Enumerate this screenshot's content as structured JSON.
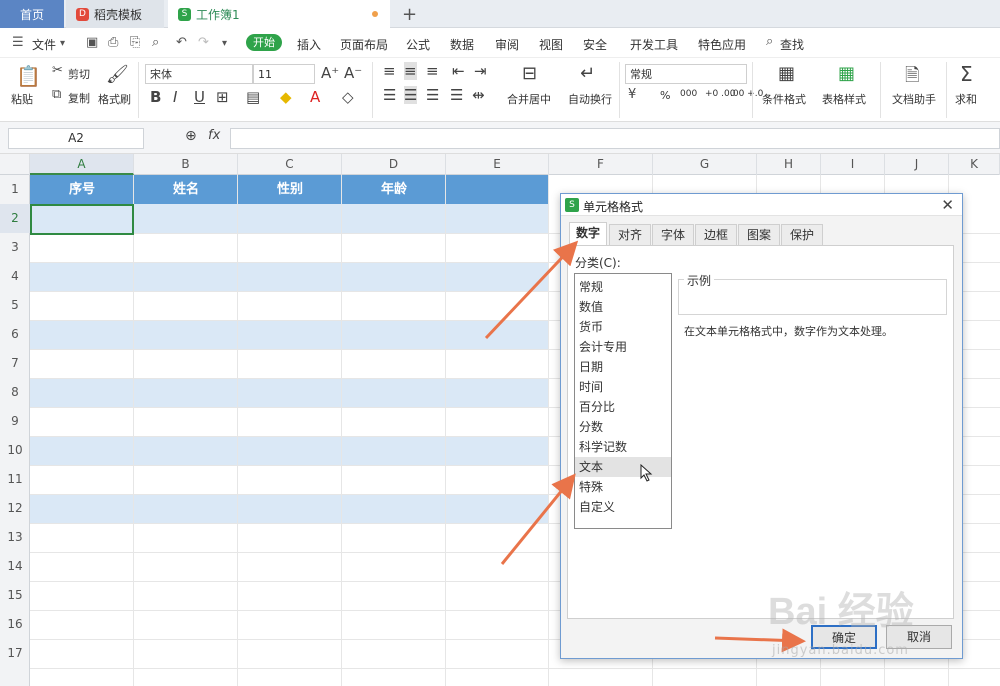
{
  "tabs": {
    "home": "首页",
    "template": "稻壳模板",
    "workbook": "工作簿1",
    "new_tab": "+"
  },
  "menu": {
    "file": "文件",
    "start": "开始",
    "items": [
      "插入",
      "页面布局",
      "公式",
      "数据",
      "审阅",
      "视图",
      "安全",
      "开发工具",
      "特色应用"
    ],
    "search": "查找"
  },
  "ribbon": {
    "paste": "粘贴",
    "cut": "剪切",
    "copy": "复制",
    "format_painter": "格式刷",
    "font_name": "宋体",
    "font_size": "11",
    "merge": "合并居中",
    "wrap": "自动换行",
    "number_format": "常规",
    "percent": "%",
    "thousands": "000",
    "inc_decimal": "+0 .00",
    "dec_decimal": ".00 +.0",
    "cond_format": "条件格式",
    "table_style": "表格样式",
    "doc_helper": "文档助手",
    "sum": "求和"
  },
  "formula_bar": {
    "cell_ref": "A2",
    "fx": "fx",
    "value": ""
  },
  "columns": [
    "A",
    "B",
    "C",
    "D",
    "E",
    "F",
    "G",
    "H",
    "I",
    "J",
    "K"
  ],
  "rows": [
    "1",
    "2",
    "3",
    "4",
    "5",
    "6",
    "7",
    "8",
    "9",
    "10",
    "11",
    "12",
    "13",
    "14",
    "15",
    "16",
    "17"
  ],
  "table_header": [
    "序号",
    "姓名",
    "性别",
    "年龄"
  ],
  "dialog": {
    "title": "单元格格式",
    "tabs": [
      "数字",
      "对齐",
      "字体",
      "边框",
      "图案",
      "保护"
    ],
    "category_label": "分类(C):",
    "categories": [
      "常规",
      "数值",
      "货币",
      "会计专用",
      "日期",
      "时间",
      "百分比",
      "分数",
      "科学记数",
      "文本",
      "特殊",
      "自定义"
    ],
    "selected_category": "文本",
    "sample_label": "示例",
    "description": "在文本单元格格式中，数字作为文本处理。",
    "ok": "确定",
    "cancel": "取消"
  },
  "watermark": {
    "logo": "Bai 经验",
    "url": "jingyan.baidu.com"
  },
  "colors": {
    "header_blue": "#5b9bd5",
    "band_blue": "#dae8f6",
    "accent_green": "#2fa34a",
    "arrow": "#e9744a"
  }
}
